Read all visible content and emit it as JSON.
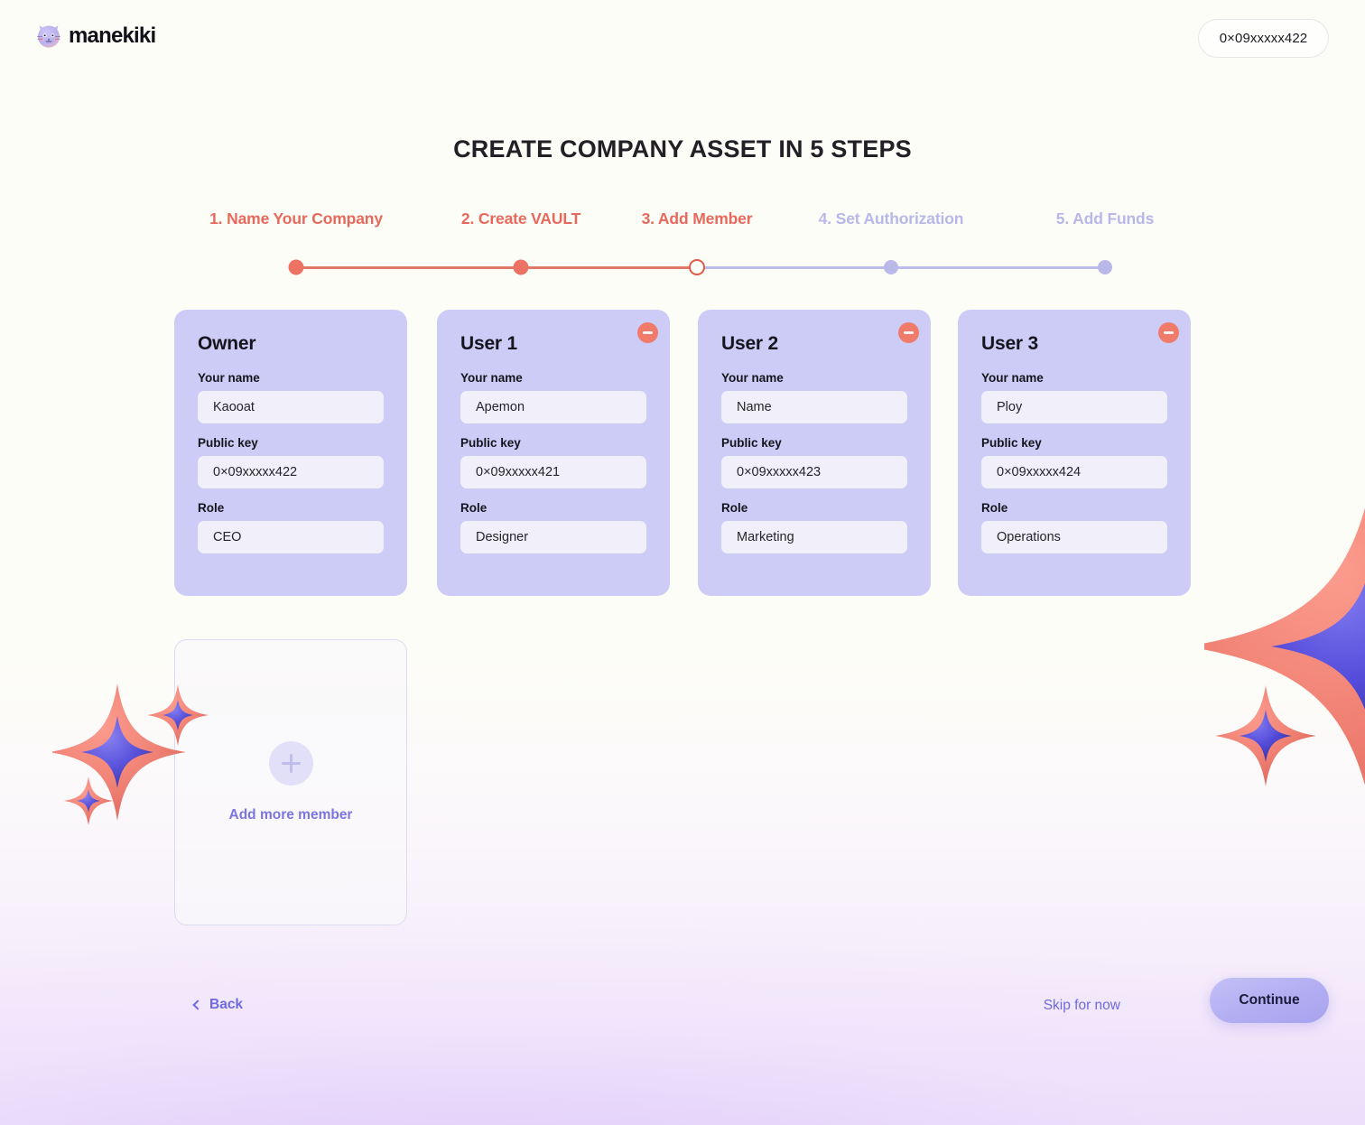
{
  "header": {
    "brand_name": "manekiki",
    "brand_icon": "cat-face-icon",
    "wallet_address": "0×09xxxxx422"
  },
  "page": {
    "title": "CREATE COMPANY ASSET IN 5 STEPS"
  },
  "stepper": {
    "steps": [
      {
        "label": "1. Name Your Company",
        "state": "done"
      },
      {
        "label": "2. Create VAULT",
        "state": "done"
      },
      {
        "label": "3. Add Member",
        "state": "current"
      },
      {
        "label": "4. Set Authorization",
        "state": "todo"
      },
      {
        "label": "5. Add Funds",
        "state": "todo"
      }
    ],
    "active_color": "#e8695c",
    "inactive_color": "#b9b7ea"
  },
  "members": {
    "field_labels": {
      "name": "Your name",
      "public_key": "Public key",
      "role": "Role"
    },
    "remove_icon": "minus-circle-icon",
    "cards": [
      {
        "title": "Owner",
        "name": "Kaooat",
        "public_key": "0×09xxxxx422",
        "role": "CEO",
        "removable": false
      },
      {
        "title": "User 1",
        "name": "Apemon",
        "public_key": "0×09xxxxx421",
        "role": "Designer",
        "removable": true
      },
      {
        "title": "User 2",
        "name": "Name",
        "public_key": "0×09xxxxx423",
        "role": "Marketing",
        "removable": true
      },
      {
        "title": "User 3",
        "name": "Ploy",
        "public_key": "0×09xxxxx424",
        "role": "Operations",
        "removable": true
      }
    ]
  },
  "add_member": {
    "label": "Add more member",
    "icon": "plus-icon"
  },
  "footer": {
    "back_label": "Back",
    "back_icon": "chevron-left-icon",
    "skip_label": "Skip for now",
    "continue_label": "Continue",
    "continue_color": "#b3aef2"
  },
  "decor": {
    "sparkle_outer_color": "#ef8073",
    "sparkle_inner_color": "#5b54dd"
  }
}
